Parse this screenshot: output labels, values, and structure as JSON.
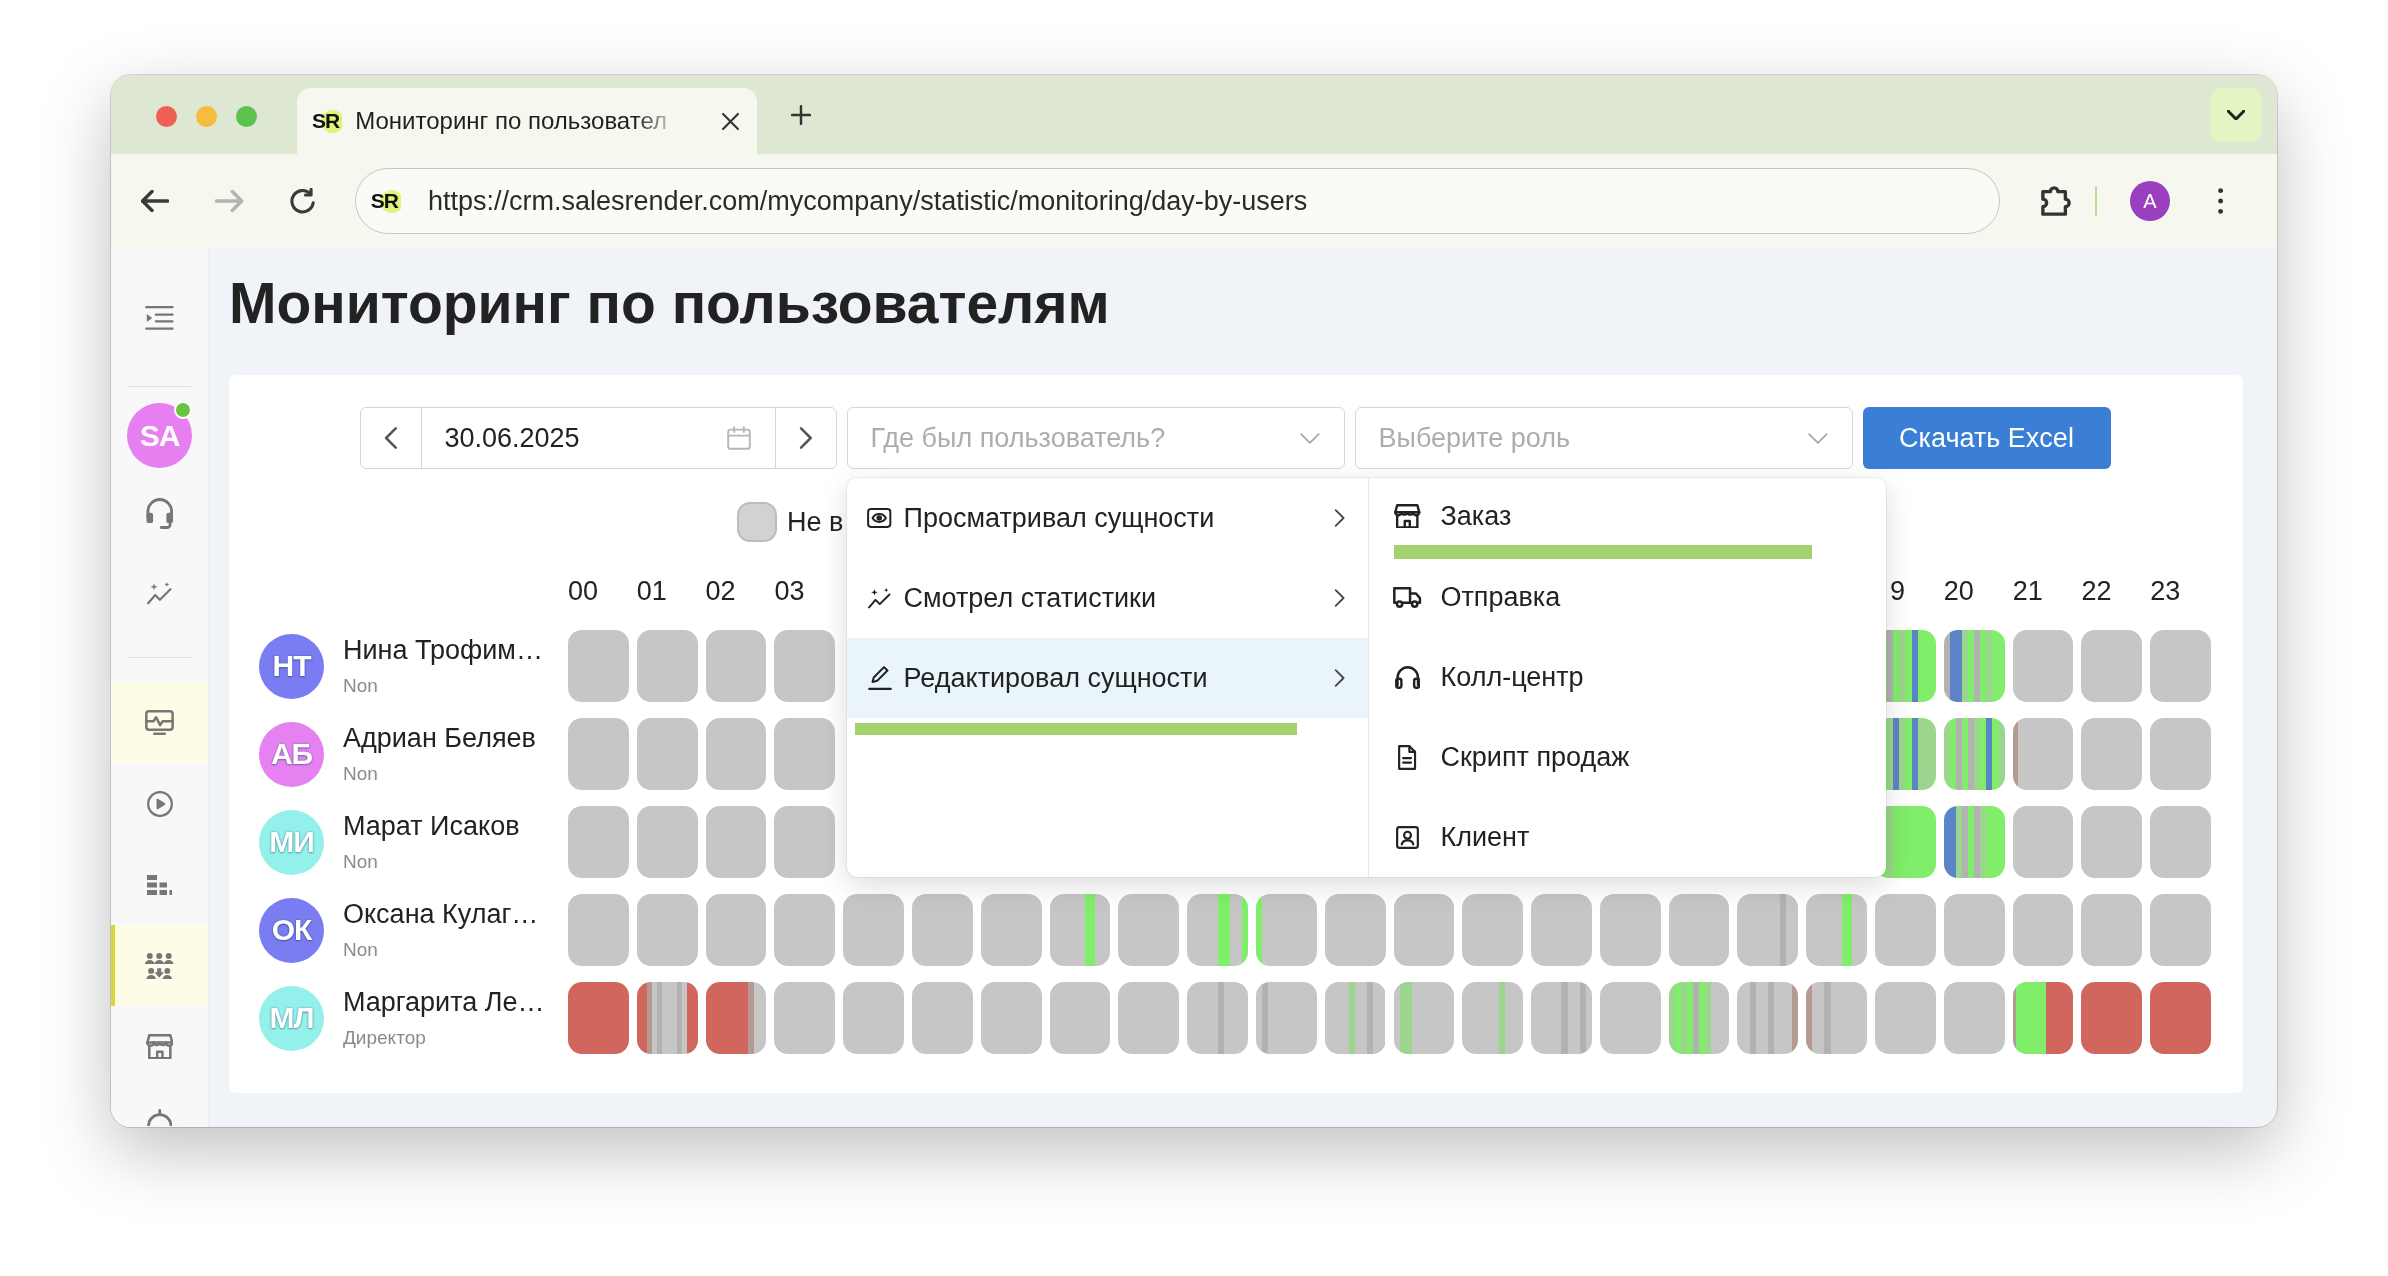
{
  "browser": {
    "tab": {
      "logo": "SR",
      "title": "Мониторинг по пользовател"
    },
    "nav": [
      {
        "kind": "back",
        "disabled": false
      },
      {
        "kind": "forward",
        "disabled": true
      },
      {
        "kind": "reload",
        "disabled": false
      }
    ],
    "address": {
      "logo": "SR",
      "url": "https://crm.salesrender.com/mycompany/statistic/monitoring/day-by-users"
    },
    "profile": "A"
  },
  "sidebar": {
    "avatar": {
      "initials": "SA",
      "online": true
    },
    "groups": [
      {
        "items": [
          {
            "kind": "headset",
            "selected": false,
            "expanded": false
          },
          {
            "kind": "analytics",
            "selected": false,
            "expanded": false
          }
        ]
      },
      {
        "items": [
          {
            "kind": "monitor",
            "selected": false,
            "expanded": true
          },
          {
            "kind": "play",
            "selected": false,
            "expanded": false
          },
          {
            "kind": "blocks",
            "selected": false,
            "expanded": false
          },
          {
            "kind": "team",
            "selected": true,
            "expanded": false
          },
          {
            "kind": "store",
            "selected": false,
            "expanded": false
          },
          {
            "kind": "partial",
            "selected": false,
            "expanded": false
          }
        ]
      }
    ]
  },
  "page": {
    "title": "Мониторинг по пользователям"
  },
  "filters": {
    "date": "30.06.2025",
    "where_select": {
      "placeholder": "Где был пользователь?",
      "menu": {
        "items": [
          {
            "kind": "eye",
            "label": "Просматривал сущности",
            "expanded": false
          },
          {
            "kind": "chart",
            "label": "Смотрел статистики",
            "expanded": false
          },
          {
            "kind": "pencil",
            "label": "Редактировал сущности",
            "expanded": true,
            "color": "#a3d16e"
          }
        ],
        "submenu": [
          {
            "kind": "store",
            "label": "Заказ",
            "color": "#a3d16e"
          },
          {
            "kind": "truck",
            "label": "Отправка"
          },
          {
            "kind": "headphones",
            "label": "Колл-центр"
          },
          {
            "kind": "document",
            "label": "Скрипт продаж"
          },
          {
            "kind": "contact",
            "label": "Клиент"
          }
        ]
      }
    },
    "role_select": {
      "placeholder": "Выберите роль"
    },
    "download_button": "Скачать Excel",
    "checkbox": {
      "label": "Не в",
      "checked": false
    }
  },
  "hours": {
    "start": [
      "00",
      "01",
      "02",
      "03"
    ],
    "end": [
      "9",
      "20",
      "21",
      "22",
      "23"
    ]
  },
  "users": [
    {
      "initials": "НТ",
      "name": "Нина Трофим…",
      "role": "Non",
      "color": "#7a7cf1",
      "activity": {
        "start": [
          [
            {
              "kind": "gray"
            }
          ],
          [
            {
              "kind": "gray"
            }
          ],
          [
            {
              "kind": "gray"
            }
          ],
          [
            {
              "kind": "gray"
            }
          ]
        ],
        "end": [
          [
            {
              "kind": "gray"
            },
            {
              "kind": "pale_green"
            },
            {
              "kind": "line"
            },
            {
              "kind": "green"
            },
            {
              "kind": "pale_green"
            },
            {
              "kind": "green"
            },
            {
              "kind": "blue"
            },
            {
              "kind": "green"
            },
            {
              "kind": "green"
            },
            {
              "kind": "green"
            }
          ],
          [
            {
              "kind": "line"
            },
            {
              "kind": "blue"
            },
            {
              "kind": "blue"
            },
            {
              "kind": "pale_green"
            },
            {
              "kind": "green"
            },
            {
              "kind": "line"
            },
            {
              "kind": "green"
            },
            {
              "kind": "pale_green"
            },
            {
              "kind": "green"
            },
            {
              "kind": "green"
            }
          ],
          [
            {
              "kind": "gray"
            }
          ],
          [
            {
              "kind": "gray"
            }
          ],
          [
            {
              "kind": "gray"
            }
          ]
        ]
      }
    },
    {
      "initials": "АБ",
      "name": "Адриан Беляев",
      "role": "Non",
      "color": "#e681f1",
      "activity": {
        "start": [
          [
            {
              "kind": "gray"
            }
          ],
          [
            {
              "kind": "gray"
            }
          ],
          [
            {
              "kind": "gray"
            }
          ],
          [
            {
              "kind": "gray"
            }
          ]
        ],
        "end": [
          [
            {
              "kind": "pale_green"
            },
            {
              "kind": "green"
            },
            {
              "kind": "pale_green"
            },
            {
              "kind": "blue"
            },
            {
              "kind": "pale_green"
            },
            {
              "kind": "green"
            },
            {
              "kind": "blue"
            },
            {
              "kind": "pale_green"
            },
            {
              "kind": "pale_green"
            },
            {
              "kind": "pale_green"
            }
          ],
          [
            {
              "kind": "pale_green"
            },
            {
              "kind": "green"
            },
            {
              "kind": "line"
            },
            {
              "kind": "green"
            },
            {
              "kind": "line"
            },
            {
              "kind": "pale_green"
            },
            {
              "kind": "green"
            },
            {
              "kind": "blue"
            },
            {
              "kind": "green"
            },
            {
              "kind": "pale_green"
            }
          ],
          [
            {
              "kind": "tan"
            },
            {
              "kind": "gray"
            },
            {
              "kind": "gray"
            },
            {
              "kind": "gray"
            },
            {
              "kind": "gray"
            },
            {
              "kind": "gray"
            },
            {
              "kind": "gray"
            },
            {
              "kind": "gray"
            },
            {
              "kind": "gray"
            },
            {
              "kind": "gray"
            },
            {
              "kind": "gray"
            },
            {
              "kind": "gray"
            }
          ],
          [
            {
              "kind": "gray"
            }
          ],
          [
            {
              "kind": "gray"
            }
          ]
        ]
      }
    },
    {
      "initials": "МИ",
      "name": "Марат Исаков",
      "role": "Non",
      "color": "#94f0ea",
      "activity": {
        "start": [
          [
            {
              "kind": "gray"
            }
          ],
          [
            {
              "kind": "gray"
            }
          ],
          [
            {
              "kind": "gray"
            }
          ],
          [
            {
              "kind": "gray"
            }
          ]
        ],
        "end": [
          [
            {
              "kind": "tan"
            },
            {
              "kind": "green"
            },
            {
              "kind": "pale_green"
            },
            {
              "kind": "green"
            },
            {
              "kind": "green"
            },
            {
              "kind": "green"
            },
            {
              "kind": "green"
            },
            {
              "kind": "green"
            },
            {
              "kind": "green"
            },
            {
              "kind": "green"
            }
          ],
          [
            {
              "kind": "blue"
            },
            {
              "kind": "blue"
            },
            {
              "kind": "pale_green"
            },
            {
              "kind": "line"
            },
            {
              "kind": "green"
            },
            {
              "kind": "line"
            },
            {
              "kind": "pale_green"
            },
            {
              "kind": "green"
            },
            {
              "kind": "green"
            },
            {
              "kind": "green"
            }
          ],
          [
            {
              "kind": "gray"
            }
          ],
          [
            {
              "kind": "gray"
            }
          ],
          [
            {
              "kind": "gray"
            }
          ]
        ]
      }
    },
    {
      "initials": "ОК",
      "name": "Оксана Кулаг…",
      "role": "Non",
      "color": "#7a7cf1",
      "activity": {
        "start": [
          [
            {
              "kind": "gray"
            }
          ],
          [
            {
              "kind": "gray"
            }
          ],
          [
            {
              "kind": "gray"
            }
          ],
          [
            {
              "kind": "gray"
            }
          ],
          [
            {
              "kind": "gray"
            }
          ],
          [
            {
              "kind": "gray"
            }
          ],
          [
            {
              "kind": "gray"
            }
          ],
          [
            {
              "kind": "gray"
            },
            {
              "kind": "gray"
            },
            {
              "kind": "gray"
            },
            {
              "kind": "gray"
            },
            {
              "kind": "gray"
            },
            {
              "kind": "gray"
            },
            {
              "kind": "gray"
            },
            {
              "kind": "green"
            },
            {
              "kind": "green"
            },
            {
              "kind": "gray"
            },
            {
              "kind": "gray"
            },
            {
              "kind": "gray"
            }
          ],
          [
            {
              "kind": "gray"
            }
          ],
          [
            {
              "kind": "gray"
            },
            {
              "kind": "gray"
            },
            {
              "kind": "gray"
            },
            {
              "kind": "gray"
            },
            {
              "kind": "gray"
            },
            {
              "kind": "green"
            },
            {
              "kind": "green"
            },
            {
              "kind": "gray"
            },
            {
              "kind": "gray"
            },
            {
              "kind": "green"
            }
          ],
          [
            {
              "kind": "green"
            },
            {
              "kind": "gray"
            },
            {
              "kind": "gray"
            },
            {
              "kind": "gray"
            },
            {
              "kind": "gray"
            },
            {
              "kind": "gray"
            },
            {
              "kind": "gray"
            },
            {
              "kind": "gray"
            },
            {
              "kind": "gray"
            },
            {
              "kind": "gray"
            }
          ],
          [
            {
              "kind": "gray"
            }
          ],
          [
            {
              "kind": "gray"
            }
          ],
          [
            {
              "kind": "gray"
            }
          ],
          [
            {
              "kind": "gray"
            }
          ],
          [
            {
              "kind": "gray"
            }
          ],
          [
            {
              "kind": "gray"
            }
          ],
          [
            {
              "kind": "gray"
            },
            {
              "kind": "gray"
            },
            {
              "kind": "gray"
            },
            {
              "kind": "gray"
            },
            {
              "kind": "gray"
            },
            {
              "kind": "gray"
            },
            {
              "kind": "gray"
            },
            {
              "kind": "line"
            },
            {
              "kind": "gray"
            },
            {
              "kind": "gray"
            }
          ],
          [
            {
              "kind": "gray"
            },
            {
              "kind": "gray"
            },
            {
              "kind": "gray"
            },
            {
              "kind": "gray"
            },
            {
              "kind": "gray"
            },
            {
              "kind": "gray"
            },
            {
              "kind": "gray"
            },
            {
              "kind": "green"
            },
            {
              "kind": "green"
            },
            {
              "kind": "gray"
            },
            {
              "kind": "gray"
            },
            {
              "kind": "gray"
            }
          ],
          [
            {
              "kind": "gray"
            }
          ],
          [
            {
              "kind": "gray"
            }
          ],
          [
            {
              "kind": "gray"
            }
          ],
          [
            {
              "kind": "gray"
            }
          ],
          [
            {
              "kind": "gray"
            }
          ]
        ]
      }
    },
    {
      "initials": "МЛ",
      "name": "Маргарита Ле…",
      "role": "Директор",
      "color": "#94f0ea",
      "activity": {
        "start": [
          [
            {
              "kind": "red"
            }
          ],
          [
            {
              "kind": "red"
            },
            {
              "kind": "red"
            },
            {
              "kind": "tan"
            },
            {
              "kind": "gray"
            },
            {
              "kind": "line"
            },
            {
              "kind": "gray"
            },
            {
              "kind": "gray"
            },
            {
              "kind": "gray"
            },
            {
              "kind": "line"
            },
            {
              "kind": "gray"
            },
            {
              "kind": "red"
            },
            {
              "kind": "red"
            }
          ],
          [
            {
              "kind": "red"
            },
            {
              "kind": "red"
            },
            {
              "kind": "red"
            },
            {
              "kind": "red"
            },
            {
              "kind": "red"
            },
            {
              "kind": "red"
            },
            {
              "kind": "red"
            },
            {
              "kind": "tan"
            },
            {
              "kind": "gray"
            },
            {
              "kind": "gray"
            }
          ],
          [
            {
              "kind": "gray"
            }
          ],
          [
            {
              "kind": "gray"
            }
          ],
          [
            {
              "kind": "gray"
            }
          ],
          [
            {
              "kind": "gray"
            }
          ],
          [
            {
              "kind": "gray"
            }
          ],
          [
            {
              "kind": "gray"
            }
          ],
          [
            {
              "kind": "gray"
            },
            {
              "kind": "gray"
            },
            {
              "kind": "gray"
            },
            {
              "kind": "gray"
            },
            {
              "kind": "gray"
            },
            {
              "kind": "line"
            },
            {
              "kind": "gray"
            },
            {
              "kind": "gray"
            },
            {
              "kind": "gray"
            },
            {
              "kind": "gray"
            }
          ],
          [
            {
              "kind": "gray"
            },
            {
              "kind": "line"
            },
            {
              "kind": "gray"
            },
            {
              "kind": "gray"
            },
            {
              "kind": "gray"
            },
            {
              "kind": "gray"
            },
            {
              "kind": "gray"
            },
            {
              "kind": "gray"
            },
            {
              "kind": "gray"
            },
            {
              "kind": "gray"
            }
          ],
          [
            {
              "kind": "gray"
            },
            {
              "kind": "gray"
            },
            {
              "kind": "gray"
            },
            {
              "kind": "gray"
            },
            {
              "kind": "pale_green"
            },
            {
              "kind": "gray"
            },
            {
              "kind": "gray"
            },
            {
              "kind": "line"
            },
            {
              "kind": "gray"
            },
            {
              "kind": "gray"
            }
          ],
          [
            {
              "kind": "gray"
            },
            {
              "kind": "pale_green"
            },
            {
              "kind": "pale_green"
            },
            {
              "kind": "gray"
            },
            {
              "kind": "gray"
            },
            {
              "kind": "gray"
            },
            {
              "kind": "gray"
            },
            {
              "kind": "gray"
            },
            {
              "kind": "gray"
            },
            {
              "kind": "gray"
            }
          ],
          [
            {
              "kind": "gray"
            },
            {
              "kind": "gray"
            },
            {
              "kind": "gray"
            },
            {
              "kind": "gray"
            },
            {
              "kind": "gray"
            },
            {
              "kind": "gray"
            },
            {
              "kind": "pale_green"
            },
            {
              "kind": "gray"
            },
            {
              "kind": "gray"
            },
            {
              "kind": "gray"
            }
          ],
          [
            {
              "kind": "gray"
            },
            {
              "kind": "gray"
            },
            {
              "kind": "gray"
            },
            {
              "kind": "gray"
            },
            {
              "kind": "gray"
            },
            {
              "kind": "line"
            },
            {
              "kind": "gray"
            },
            {
              "kind": "gray"
            },
            {
              "kind": "line"
            },
            {
              "kind": "gray"
            }
          ],
          [
            {
              "kind": "gray"
            }
          ],
          [
            {
              "kind": "pale_green"
            },
            {
              "kind": "green"
            },
            {
              "kind": "pale_green"
            },
            {
              "kind": "green"
            },
            {
              "kind": "line"
            },
            {
              "kind": "green"
            },
            {
              "kind": "pale_green"
            },
            {
              "kind": "gray"
            },
            {
              "kind": "gray"
            },
            {
              "kind": "gray"
            }
          ],
          [
            {
              "kind": "gray"
            },
            {
              "kind": "gray"
            },
            {
              "kind": "line"
            },
            {
              "kind": "gray"
            },
            {
              "kind": "gray"
            },
            {
              "kind": "line"
            },
            {
              "kind": "gray"
            },
            {
              "kind": "gray"
            },
            {
              "kind": "gray"
            },
            {
              "kind": "tan"
            }
          ],
          [
            {
              "kind": "tan"
            },
            {
              "kind": "gray"
            },
            {
              "kind": "gray"
            },
            {
              "kind": "line"
            },
            {
              "kind": "gray"
            },
            {
              "kind": "gray"
            },
            {
              "kind": "gray"
            },
            {
              "kind": "gray"
            },
            {
              "kind": "gray"
            },
            {
              "kind": "gray"
            }
          ],
          [
            {
              "kind": "gray"
            }
          ],
          [
            {
              "kind": "gray"
            }
          ],
          [
            {
              "kind": "tan"
            },
            {
              "kind": "green"
            },
            {
              "kind": "green"
            },
            {
              "kind": "green"
            },
            {
              "kind": "green"
            },
            {
              "kind": "green"
            },
            {
              "kind": "green"
            },
            {
              "kind": "green"
            },
            {
              "kind": "green"
            },
            {
              "kind": "green"
            },
            {
              "kind": "green"
            },
            {
              "kind": "red"
            },
            {
              "kind": "red"
            },
            {
              "kind": "red"
            },
            {
              "kind": "red"
            },
            {
              "kind": "red"
            },
            {
              "kind": "red"
            },
            {
              "kind": "red"
            },
            {
              "kind": "red"
            },
            {
              "kind": "red"
            }
          ],
          [
            {
              "kind": "red"
            }
          ],
          [
            {
              "kind": "red"
            }
          ]
        ]
      }
    }
  ]
}
